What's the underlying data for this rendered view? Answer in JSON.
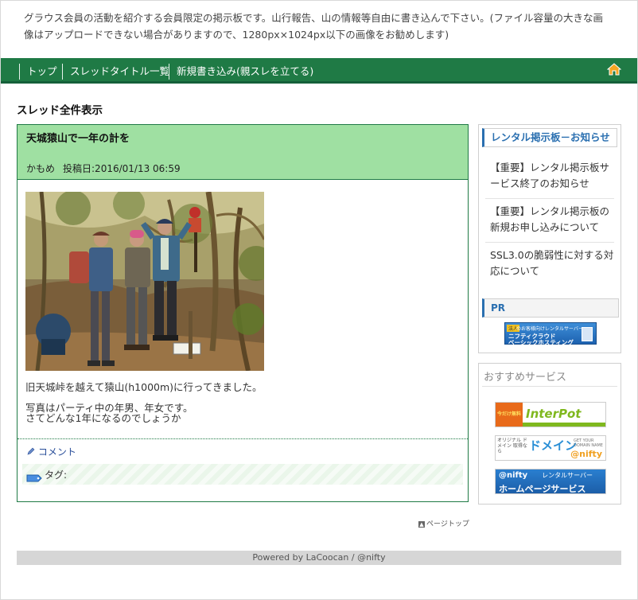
{
  "header": {
    "description": "グラウス会員の活動を紹介する会員限定の掲示板です。山行報告、山の情報等自由に書き込んで下さい。(ファイル容量の大きな画像はアップロードできない場合がありますので、1280px×1024px以下の画像をお勧めします)"
  },
  "nav": {
    "items": [
      {
        "label": "トップ"
      },
      {
        "label": "スレッドタイトル一覧"
      },
      {
        "label": "新規書き込み(親スレを立てる)"
      }
    ],
    "home_icon": "home-icon"
  },
  "main": {
    "section_title": "スレッド全件表示",
    "post": {
      "title": "天城猿山で一年の計を",
      "author": "かもめ",
      "date": "投稿日:2016/01/13 06:59",
      "photo_alt": "hikers-photo",
      "body": [
        "旧天城峠を越えて猿山(h1000m)に行ってきました。",
        "",
        "写真はパーティ中の年男、年女です。",
        "さてどんな1年になるのでしょうか"
      ],
      "comment_link": "コメント",
      "tag_label": "タグ:"
    },
    "page_top": "ページトップ"
  },
  "sidebar": {
    "notice_title": "レンタル掲示板－お知らせ",
    "notices": [
      {
        "text": "【重要】レンタル掲示板サービス終了のお知らせ"
      },
      {
        "text": "【重要】レンタル掲示板の新規お申し込みについて"
      },
      {
        "text": "SSL3.0の脆弱性に対する対応について"
      }
    ],
    "pr_title": "PR",
    "pr_banner": {
      "tag": "法人",
      "line1": "のお客様向けレンタルサーバー",
      "line2": "ニフティクラウド",
      "line3": "ベーシックホスティング"
    },
    "recommend_title": "おすすめサービス",
    "banners": {
      "interpot_side": "今だけ無料",
      "interpot_logo": "InterPot",
      "domain_side": "オリジナル ドメイン 取得なら",
      "domain_logo": "ドメイン",
      "domain_small": "GET YOUR DOMAIN NAME",
      "domain_brand": "@nifty",
      "home_brand": "@nifty",
      "home_rental": "レンタルサーバー",
      "home_main": "ホームページサービス"
    }
  },
  "footer": {
    "text": "Powered by LaCoocan / @nifty"
  }
}
